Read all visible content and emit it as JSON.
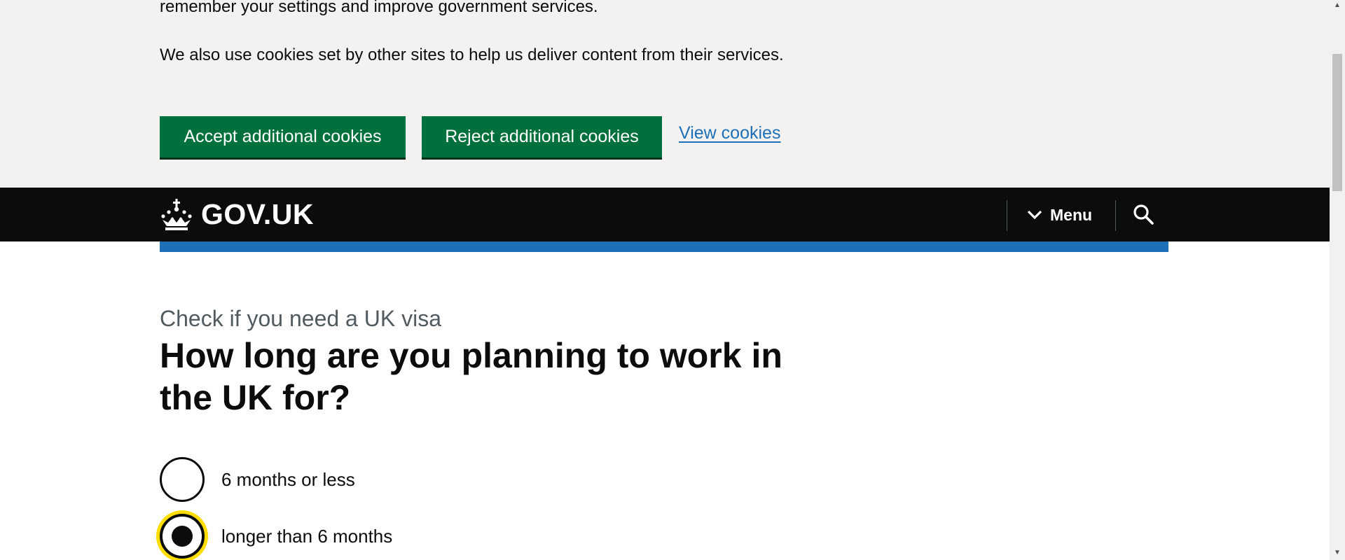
{
  "cookie_banner": {
    "paragraph_1": "remember your settings and improve government services.",
    "paragraph_2": "We also use cookies set by other sites to help us deliver content from their services.",
    "accept_label": "Accept additional cookies",
    "reject_label": "Reject additional cookies",
    "view_label": "View cookies"
  },
  "header": {
    "logo_text": "GOV.UK",
    "logo_icon": "crown-icon",
    "menu_label": "Menu",
    "menu_icon": "chevron-down-icon",
    "search_icon": "search-icon"
  },
  "main": {
    "caption": "Check if you need a UK visa",
    "heading": "How long are you planning to work in the UK for?",
    "options": [
      {
        "label": "6 months or less",
        "selected": false
      },
      {
        "label": "longer than 6 months",
        "selected": true
      }
    ]
  },
  "colors": {
    "banner_bg": "#f3f2f1",
    "button_green": "#00703c",
    "link_blue": "#1d70b8",
    "header_black": "#0b0c0c",
    "focus_yellow": "#ffdd00",
    "caption_grey": "#505a5f"
  }
}
